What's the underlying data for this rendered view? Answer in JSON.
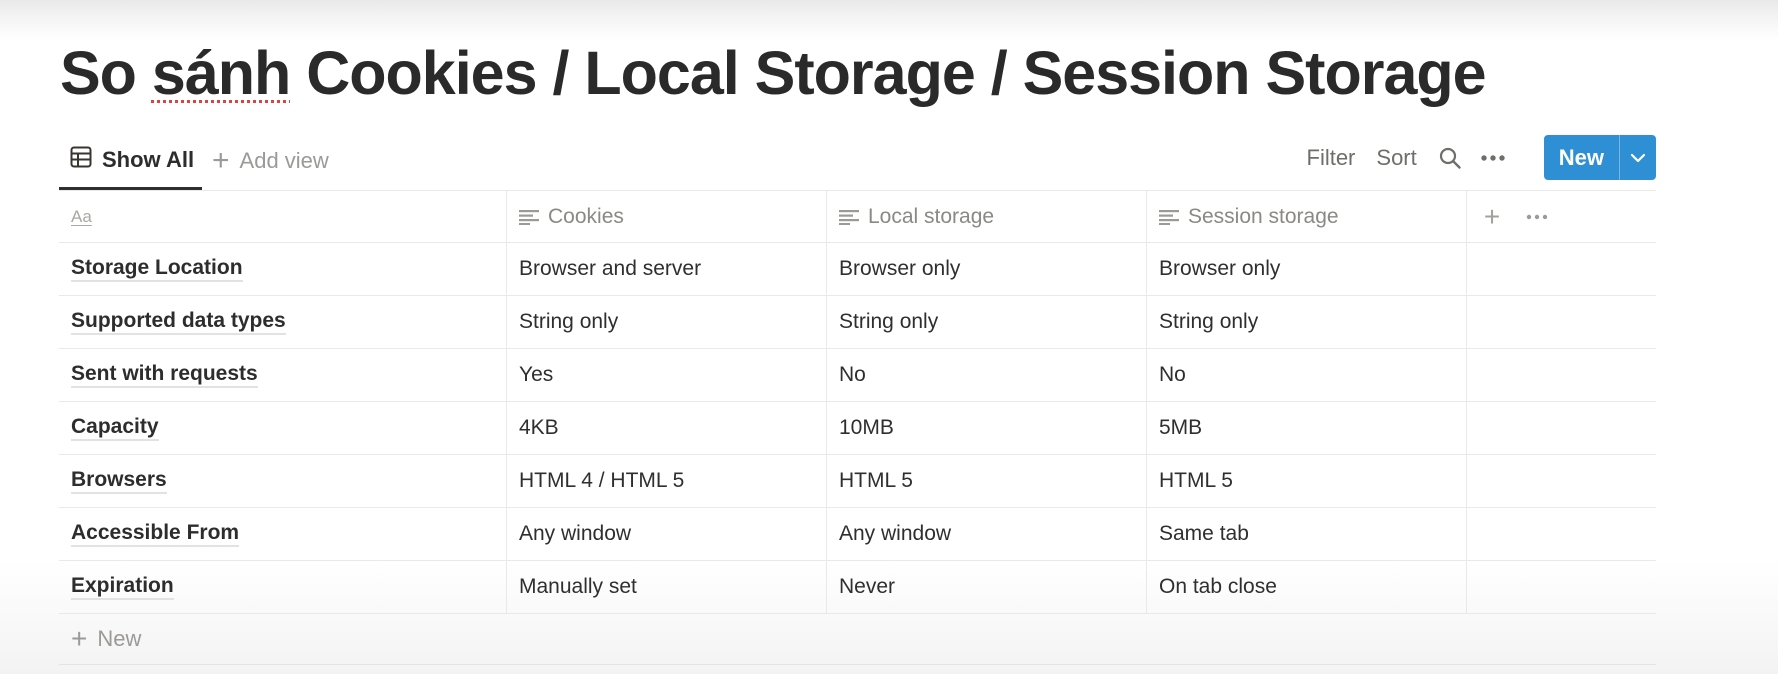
{
  "page": {
    "title_before": "So ",
    "title_spell": "sánh",
    "title_after": " Cookies / Local Storage / Session Storage"
  },
  "views": {
    "active_tab": "Show All",
    "active_tab_icon": "table-icon",
    "add_view_label": "Add view"
  },
  "toolbar": {
    "filter_label": "Filter",
    "sort_label": "Sort",
    "search_icon": "search-icon",
    "more_icon": "more-horizontal-icon",
    "new_label": "New",
    "new_caret_icon": "chevron-down-icon",
    "accent_color": "#2f8fd5"
  },
  "table": {
    "columns": [
      {
        "label": "Aa",
        "type": "title"
      },
      {
        "label": "Cookies",
        "type": "text"
      },
      {
        "label": "Local storage",
        "type": "text"
      },
      {
        "label": "Session storage",
        "type": "text"
      }
    ],
    "rows": [
      {
        "name": "Storage Location",
        "cookies": "Browser and server",
        "local": "Browser only",
        "session": "Browser only"
      },
      {
        "name": "Supported data types",
        "cookies": "String only",
        "local": "String only",
        "session": "String only"
      },
      {
        "name": "Sent with requests",
        "cookies": "Yes",
        "local": "No",
        "session": "No"
      },
      {
        "name": "Capacity",
        "cookies": "4KB",
        "local": "10MB",
        "session": "5MB"
      },
      {
        "name": "Browsers",
        "cookies": "HTML 4 / HTML 5",
        "local": "HTML 5",
        "session": "HTML 5"
      },
      {
        "name": "Accessible From",
        "cookies": "Any window",
        "local": "Any window",
        "session": "Same tab"
      },
      {
        "name": "Expiration",
        "cookies": "Manually set",
        "local": "Never",
        "session": "On tab close"
      }
    ],
    "new_row_label": "New"
  }
}
